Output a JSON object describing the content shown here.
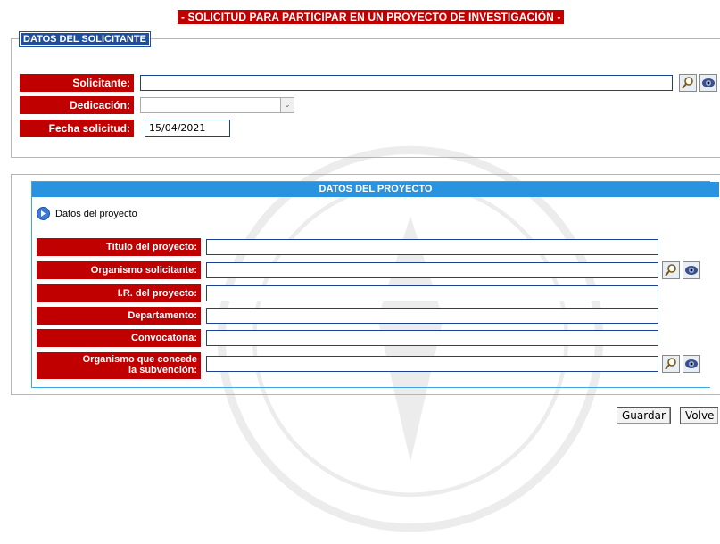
{
  "page_title": "- SOLICITUD PARA PARTICIPAR EN UN PROYECTO DE INVESTIGACIÓN -",
  "solicitante_section": {
    "legend": "DATOS DEL SOLICITANTE",
    "fields": {
      "solicitante": {
        "label": "Solicitante:",
        "value": ""
      },
      "dedicacion": {
        "label": "Dedicación:",
        "value": ""
      },
      "fecha": {
        "label": "Fecha solicitud:",
        "value": "15/04/2021"
      }
    }
  },
  "proyecto_section": {
    "header": "DATOS DEL PROYECTO",
    "toggle_label": "Datos del proyecto",
    "fields": {
      "titulo": {
        "label": "Título del proyecto:",
        "value": ""
      },
      "organismo": {
        "label": "Organismo solicitante:",
        "value": ""
      },
      "ir": {
        "label": "I.R. del proyecto:",
        "value": ""
      },
      "departamento": {
        "label": "Departamento:",
        "value": ""
      },
      "convocatoria": {
        "label": "Convocatoria:",
        "value": ""
      },
      "subvencion_line1": "Organismo que concede",
      "subvencion_line2": "la subvención:",
      "subvencion_value": ""
    }
  },
  "buttons": {
    "guardar": "Guardar",
    "volver": "Volve"
  },
  "colors": {
    "label_red": "#c00000",
    "legend_blue": "#1f4e9c",
    "header_blue": "#2a93e0"
  },
  "icons": [
    "search-icon",
    "eye-icon",
    "info-circle-icon",
    "chevron-down-icon"
  ]
}
